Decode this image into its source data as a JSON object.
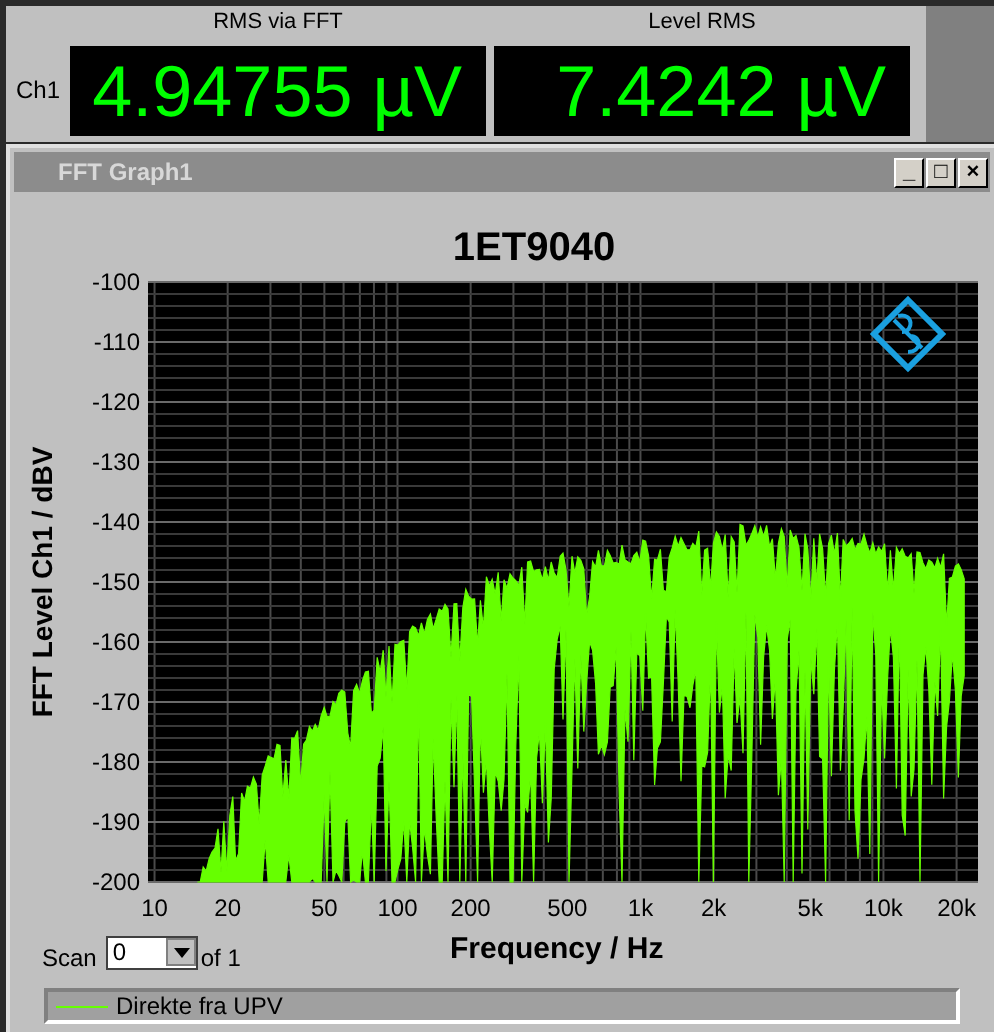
{
  "readings": {
    "channel": "Ch1",
    "items": [
      {
        "label": "RMS via FFT",
        "value": "4.94755 µV"
      },
      {
        "label": "Level RMS",
        "value": "7.4242 µV"
      }
    ]
  },
  "window": {
    "title": "FFT Graph1",
    "buttons": [
      "_",
      "□",
      "×"
    ]
  },
  "graph": {
    "title": "1ET9040",
    "xlabel": "Frequency / Hz",
    "ylabel": "FFT Level Ch1 / dBV",
    "y_tick_labels": [
      "-100",
      "-110",
      "-120",
      "-130",
      "-140",
      "-150",
      "-160",
      "-170",
      "-180",
      "-190",
      "-200"
    ],
    "x_tick_labels": [
      "10",
      "20",
      "50",
      "100",
      "200",
      "500",
      "1k",
      "2k",
      "5k",
      "10k",
      "20k"
    ],
    "legend": [
      "Direkte fra UPV"
    ]
  },
  "scan": {
    "label": "Scan",
    "value": "0",
    "suffix": "of 1"
  }
}
